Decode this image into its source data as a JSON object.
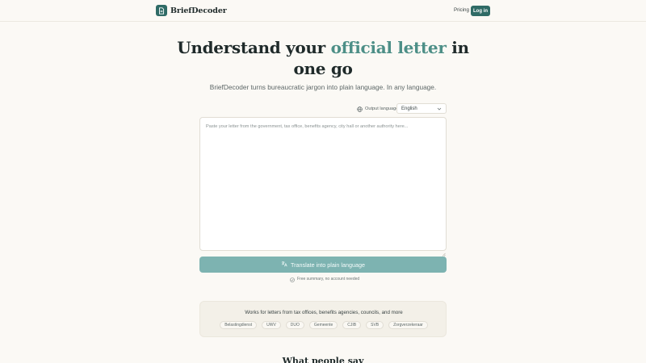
{
  "header": {
    "brand_name": "BriefDecoder",
    "nav_pricing": "Pricing",
    "nav_login": "Log in"
  },
  "hero": {
    "title_part1": "Understand your ",
    "title_accent": "official letter",
    "title_part2": " in one go",
    "subtitle": "BriefDecoder turns bureaucratic jargon into plain language. In any language."
  },
  "language": {
    "label": "Output language",
    "selected": "English"
  },
  "input": {
    "placeholder": "Paste your letter from the government, tax office, benefits agency, city hall or another authority here...",
    "value": ""
  },
  "translate_button": "Translate into plain language",
  "free_note": "Free summary, no account needed",
  "works_for": {
    "title": "Works for letters from tax offices, benefits agencies, councils, and more",
    "chips": [
      "Belastingdienst",
      "UWV",
      "DUO",
      "Gemeente",
      "CJIB",
      "SVB",
      "Zorgverzekeraar"
    ]
  },
  "testimonials": {
    "title": "What people say"
  },
  "colors": {
    "primary": "#2f6b66",
    "accent": "#4d8f87",
    "button_disabled": "#7db3b1",
    "background": "#fbf9f5"
  }
}
